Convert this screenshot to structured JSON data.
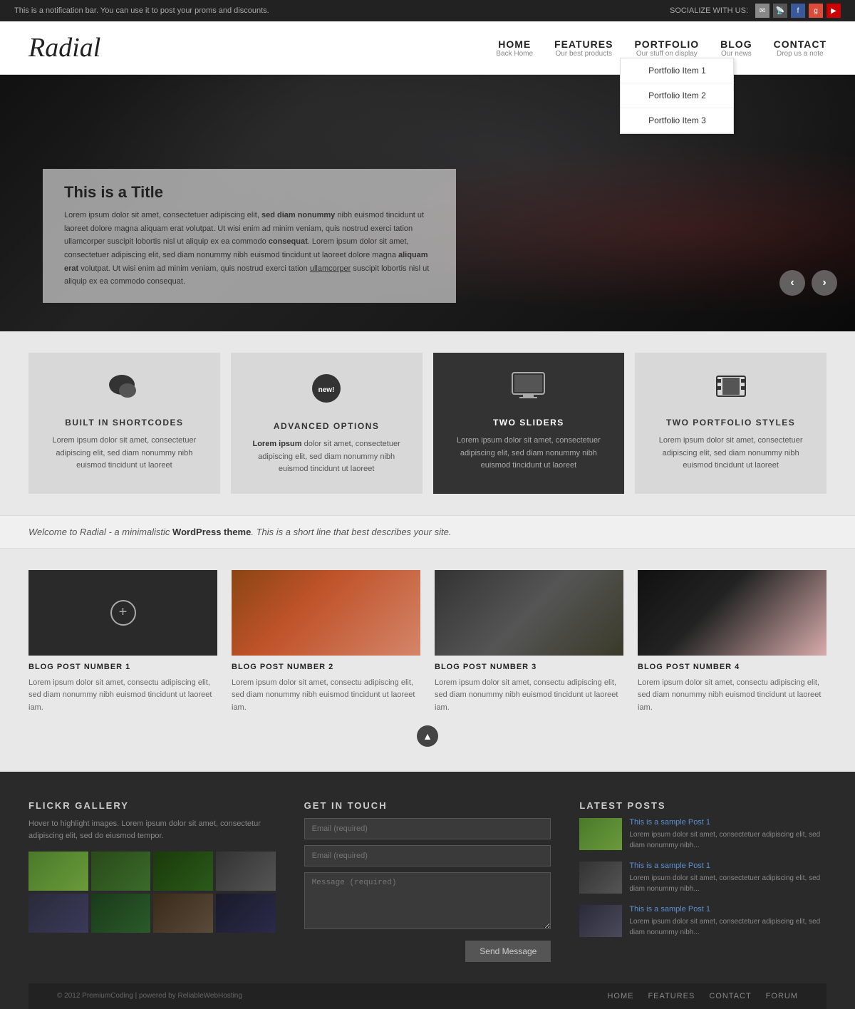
{
  "notification": {
    "text": "This is a notification bar. You can use it to post your proms and discounts.",
    "socialize": "SOCIALIZE WITH US:"
  },
  "header": {
    "logo": "Radial",
    "nav": [
      {
        "label": "HOME",
        "sub": "Back Home"
      },
      {
        "label": "FEATURES",
        "sub": "Our best products"
      },
      {
        "label": "PORTFOLIO",
        "sub": "Our stuff on display"
      },
      {
        "label": "BLOG",
        "sub": "Our news"
      },
      {
        "label": "CONTACT",
        "sub": "Drop us a note"
      }
    ],
    "portfolio_dropdown": [
      "Portfolio Item 1",
      "Portfolio Item 2",
      "Portfolio Item 3"
    ]
  },
  "hero": {
    "title": "This is a Title",
    "text": "Lorem ipsum dolor sit amet, consectetuer adipiscing elit, sed diam nonummy nibh euismod tincidunt ut laoreet dolore magna aliquam erat volutpat. Ut wisi enim ad minim veniam, quis nostrud exerci tation ullamcorper suscipit lobortis nisl ut aliquip ex ea commodo consequat. Lorem ipsum dolor sit amet, consectetuer adipiscing elit, sed diam nonummy nibh euismod tincidunt ut laoreet dolore magna aliquam erat volutpat. Ut wisi enim ad minim veniam, quis nostrud exerci tation ullamcorper suscipit lobortis nisl ut aliquip ex ea commodo consequat.",
    "prev": "‹",
    "next": "›"
  },
  "features": [
    {
      "icon": "💬",
      "title": "BUILT IN SHORTCODES",
      "text": "Lorem ipsum dolor sit amet, consectetuer adipiscing elit, sed diam nonummy nibh euismod tincidunt ut laoreet",
      "dark": false
    },
    {
      "icon": "🏷",
      "title": "ADVANCED OPTIONS",
      "text": "Lorem ipsum dolor sit amet, consectetuer adipiscing elit, sed diam nonummy nibh euismod tincidunt ut laoreet",
      "dark": false
    },
    {
      "icon": "🖥",
      "title": "TWO SLIDERS",
      "text": "Lorem ipsum dolor sit amet, consectetuer adipiscing elit, sed diam nonummy nibh euismod tincidunt ut laoreet",
      "dark": true
    },
    {
      "icon": "🎬",
      "title": "TWO PORTFOLIO STYLES",
      "text": "Lorem ipsum dolor sit amet, consectetuer adipiscing elit, sed diam nonummy nibh euismod tincidunt ut laoreet",
      "dark": false
    }
  ],
  "welcome": {
    "text": "Welcome to Radial - a minimalistic ",
    "bold": "WordPress theme",
    "text2": ". This is a short line that best describes your site."
  },
  "blog": {
    "posts": [
      {
        "title": "BLOG POST NUMBER 1",
        "text": "Lorem ipsum dolor sit amet, consectu adipiscing elit, sed diam nonummy nibh euismod tincidunt ut laoreet iam."
      },
      {
        "title": "BLOG POST NUMBER 2",
        "text": "Lorem ipsum dolor sit amet, consectu adipiscing elit, sed diam nonummy nibh euismod tincidunt ut laoreet iam."
      },
      {
        "title": "BLOG POST NUMBER 3",
        "text": "Lorem ipsum dolor sit amet, consectu adipiscing elit, sed diam nonummy nibh euismod tincidunt ut laoreet iam."
      },
      {
        "title": "BLOG POST NUMBER 4",
        "text": "Lorem ipsum dolor sit amet, consectu adipiscing elit, sed diam nonummy nibh euismod tincidunt ut laoreet iam."
      }
    ]
  },
  "footer": {
    "flickr": {
      "title": "FLICKR GALLERY",
      "desc": "Hover to highlight images. Lorem ipsum dolor sit amet, consectetur adipiscing elit, sed do eiusmod tempor."
    },
    "contact": {
      "title": "GET IN TOUCH",
      "email_placeholder1": "Email (required)",
      "email_placeholder2": "Email (required)",
      "message_placeholder": "Message (required)",
      "send_label": "Send Message"
    },
    "latest": {
      "title": "LATEST POSTS",
      "posts": [
        {
          "title": "This is a sample Post 1",
          "text": "Lorem ipsum dolor sit amet, consectetuer adipiscing elit, sed diam nonummy nibh..."
        },
        {
          "title": "This is a sample Post 1",
          "text": "Lorem ipsum dolor sit amet, consectetuer adipiscing elit, sed diam nonummy nibh..."
        },
        {
          "title": "This is a sample Post 1",
          "text": "Lorem ipsum dolor sit amet, consectetuer adipiscing elit, sed diam nonummy nibh..."
        }
      ]
    },
    "copyright": "© 2012 PremiumCoding | powered by ReliableWebHosting",
    "nav": [
      "HOME",
      "FEATURES",
      "CONTACT",
      "FORUM"
    ]
  }
}
